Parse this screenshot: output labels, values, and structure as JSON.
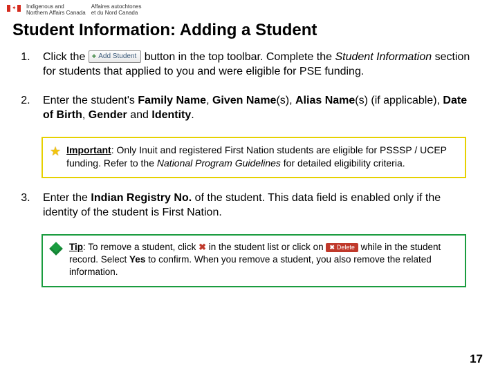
{
  "header": {
    "org_en": "Indigenous and\nNorthern Affairs Canada",
    "org_fr": "Affaires autochtones\net du Nord Canada"
  },
  "title": "Student Information: Adding a Student",
  "buttons": {
    "add_student": "Add Student",
    "delete": "Delete"
  },
  "steps": {
    "s1": {
      "pre": "Click the ",
      "post_a": " button in the top toolbar. Complete the ",
      "post_b": "Student Information",
      "post_c": " section for students that applied to you and were eligible for PSE funding."
    },
    "s2": {
      "a": "Enter the student's ",
      "family": "Family Name",
      "c1": ", ",
      "given": "Given Name",
      "paren_s1": "(s), ",
      "alias": "Alias Name",
      "paren_s2": "(s) (if applicable), ",
      "dob": "Date of Birth",
      "c2": ", ",
      "gender": "Gender",
      "and": " and ",
      "identity": "Identity",
      "end": "."
    },
    "s3": {
      "a": "Enter the ",
      "reg": "Indian Registry No.",
      "b": " of the student. This data field is enabled only if the identity of the student is First Nation."
    }
  },
  "important": {
    "label": "Important",
    "text_a": ": Only Inuit and registered First Nation students are eligible for PSSSP / UCEP funding. Refer to the ",
    "guide": "National Program Guidelines",
    "text_b": " for detailed eligibility criteria."
  },
  "tip": {
    "label": "Tip",
    "a": ": To remove a student, click ",
    "b": " in the student list or click on ",
    "c": " while in the student record. Select ",
    "yes": "Yes",
    "d": " to confirm. When you remove a student, you also remove the related information."
  },
  "page_number": "17"
}
